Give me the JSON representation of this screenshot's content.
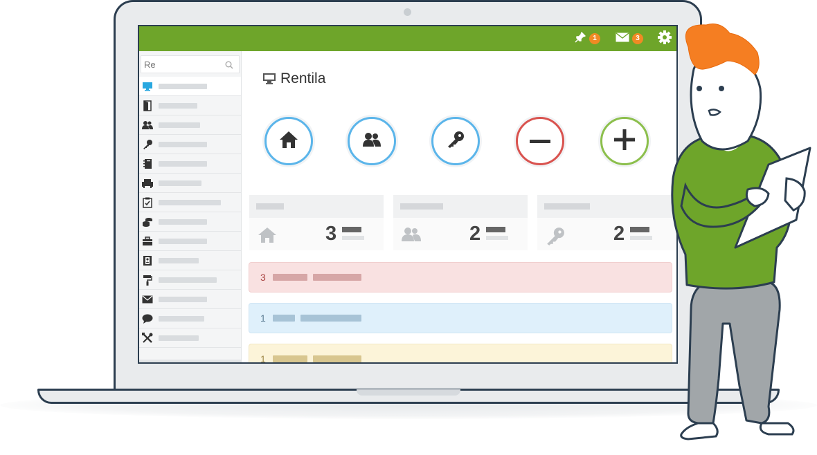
{
  "app": {
    "title": "Rentila"
  },
  "topbar": {
    "notifications": [
      {
        "icon": "pin-icon",
        "count": "1"
      },
      {
        "icon": "mail-icon",
        "count": "3"
      }
    ],
    "settings_icon": "gear-icon"
  },
  "search": {
    "value": "Re"
  },
  "sidebar": {
    "items": [
      {
        "icon": "monitor-icon"
      },
      {
        "icon": "door-icon"
      },
      {
        "icon": "users-icon"
      },
      {
        "icon": "key-icon"
      },
      {
        "icon": "notebook-icon"
      },
      {
        "icon": "armchair-icon"
      },
      {
        "icon": "clipboard-check-icon"
      },
      {
        "icon": "coins-icon"
      },
      {
        "icon": "briefcase-icon"
      },
      {
        "icon": "contacts-book-icon"
      },
      {
        "icon": "paint-roller-icon"
      },
      {
        "icon": "envelope-icon"
      },
      {
        "icon": "chat-icon"
      },
      {
        "icon": "tools-icon"
      }
    ]
  },
  "quick_actions": [
    {
      "icon": "home-icon",
      "color": "#5bb5ea"
    },
    {
      "icon": "users-icon",
      "color": "#5bb5ea"
    },
    {
      "icon": "key-icon",
      "color": "#5bb5ea"
    },
    {
      "icon": "minus-icon",
      "color": "#d9534f"
    },
    {
      "icon": "plus-icon",
      "color": "#8cbf4c"
    }
  ],
  "summary_cards": [
    {
      "icon": "home-icon",
      "value": "3"
    },
    {
      "icon": "users-icon",
      "value": "2"
    },
    {
      "icon": "key-icon",
      "value": "2"
    }
  ],
  "alerts": [
    {
      "count": "3",
      "type": "danger",
      "bg": "#f9e1e1",
      "text_color": "#a94442"
    },
    {
      "count": "1",
      "type": "info",
      "bg": "#dff0fb",
      "text_color": "#5f7f95"
    },
    {
      "count": "1",
      "type": "warning",
      "bg": "#fcf4d9",
      "text_color": "#a08a4a"
    }
  ],
  "colors": {
    "brand_green": "#6ea52a",
    "badge_orange": "#f08a24"
  }
}
